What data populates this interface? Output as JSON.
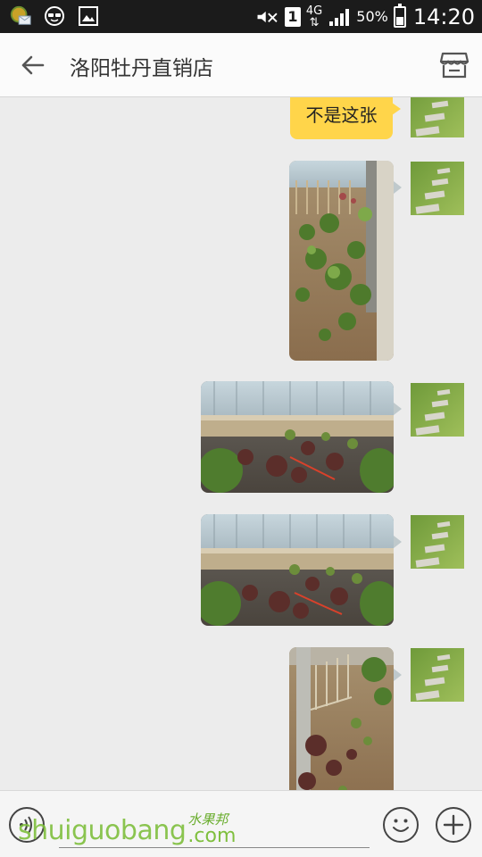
{
  "status_bar": {
    "network": "4G",
    "sim_slot": "1",
    "battery_percent": "50%",
    "battery_level": 0.5,
    "time": "14:20",
    "icons": [
      "notification-icon",
      "sunglasses-icon",
      "gallery-icon",
      "mute-icon",
      "signal-icon"
    ]
  },
  "header": {
    "title": "洛阳牡丹直销店",
    "back_icon": "arrow-back-icon",
    "shop_icon": "store-icon"
  },
  "messages": [
    {
      "type": "text",
      "text": "不是这张",
      "sender": "self"
    },
    {
      "type": "image",
      "subject": "garden-portrait-1",
      "sender": "self"
    },
    {
      "type": "image",
      "subject": "garden-landscape-1",
      "sender": "self"
    },
    {
      "type": "image",
      "subject": "garden-landscape-2",
      "sender": "self"
    },
    {
      "type": "image",
      "subject": "garden-portrait-2",
      "sender": "self"
    }
  ],
  "input": {
    "value": "",
    "placeholder": "",
    "voice_icon": "voice-icon",
    "emoji_icon": "smiley-icon",
    "plus_icon": "plus-icon"
  },
  "watermark": {
    "main": "shuiguobang",
    "cn": "水果邦",
    "suffix": ".com"
  },
  "colors": {
    "bubble": "#ffd54a",
    "chat_bg": "#ececec",
    "status_bg": "#1b1b1b"
  }
}
